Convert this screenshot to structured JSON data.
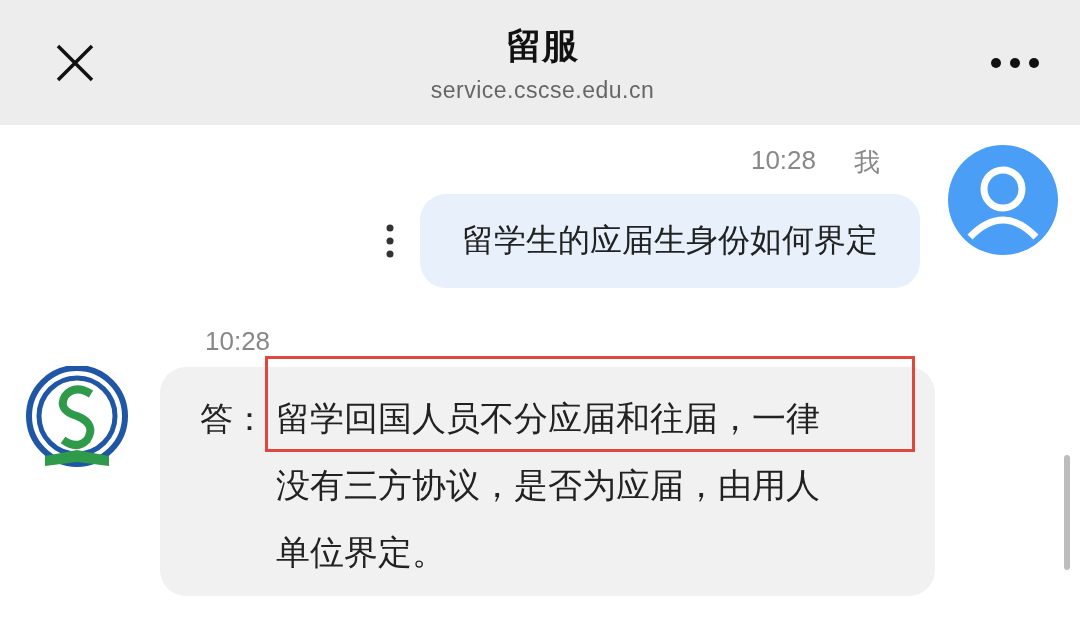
{
  "header": {
    "title": "留服",
    "subtitle": "service.cscse.edu.cn"
  },
  "messages": [
    {
      "kind": "outgoing",
      "time": "10:28",
      "sender": "我",
      "text": "留学生的应届生身份如何界定"
    },
    {
      "kind": "incoming",
      "time": "10:28",
      "prefix": "答：",
      "text": "留学回国人员不分应届和往届，一律没有三方协议，是否为应届，由用人单位界定。",
      "highlight_first_line": true
    }
  ]
}
